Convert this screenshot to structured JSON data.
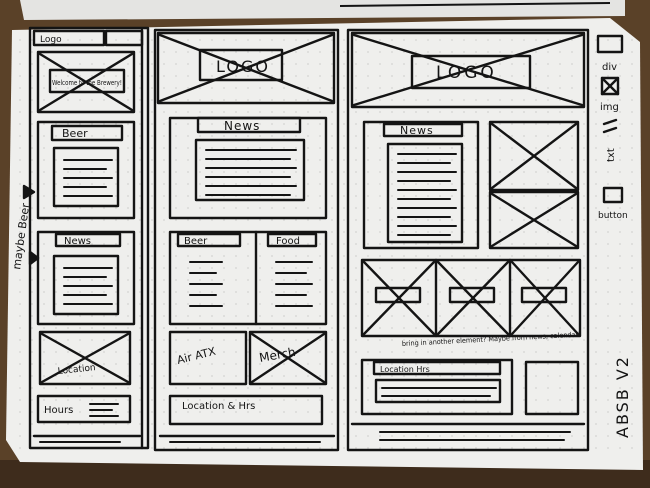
{
  "sketch": {
    "mobile": {
      "header_left": "Logo",
      "welcome": "Welcome to the Brewery!",
      "beer": "Beer",
      "news": "News",
      "location": "Location",
      "hours": "Hours"
    },
    "tablet": {
      "logo": "LOGO",
      "news": "News",
      "beer": "Beer",
      "food": "Food",
      "air_atx": "Air ATX",
      "merch": "Merch",
      "location_hrs": "Location & Hrs"
    },
    "desktop": {
      "logo": "LOGO",
      "news": "News",
      "note": "bring in another element? Maybe from news, calendar?",
      "location_hrs": "Location Hrs"
    },
    "side_note": "maybe Beer",
    "legend": {
      "div": "div",
      "img": "img",
      "txt": "txt",
      "button": "button"
    },
    "version": "ABSB V2"
  },
  "colors": {
    "paper": "#efefed",
    "ink": "#141414",
    "desk": "#5a4128"
  }
}
